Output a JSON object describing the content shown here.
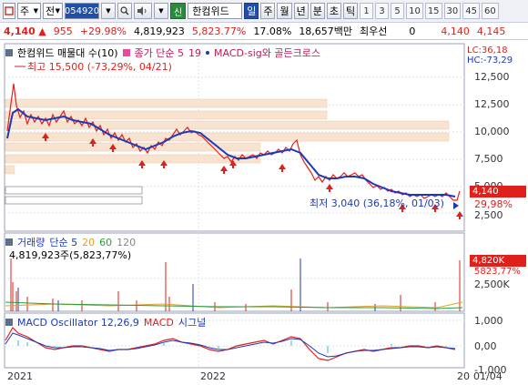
{
  "toolbar": {
    "market": "주",
    "market_sel": "전",
    "code": "054920",
    "sin": "신",
    "stock_name": "한컴위드",
    "periods": [
      "일",
      "주",
      "월",
      "년",
      "분",
      "초",
      "틱"
    ],
    "active_period": "일",
    "intervals": [
      "1",
      "3",
      "5",
      "10",
      "15",
      "30",
      "45",
      "60"
    ]
  },
  "quote": {
    "price": "4,140",
    "change": "955",
    "change_pct": "+29.98%",
    "volume": "4,819,923",
    "volume_ratio": "5,823.77%",
    "turnover": "17.08%",
    "amount": "18,657백만",
    "priority": "최우선",
    "priority_val": "0",
    "bid_price": "4,140",
    "ask_price": "4,145"
  },
  "chart": {
    "main_legend": {
      "name": "한컴위드 매물대 수(10)",
      "ma_label": "종가 단순 5",
      "ma_val": "19",
      "macd_label": "MACD-sig와 골든크로스"
    },
    "high_label": "최고 15,500 (-73,29%, 04/21)",
    "low_label": "최저 3,040 (36,18%, 01/03)",
    "lc_label": "LC:36,18",
    "hc_label": "HC:-73,29",
    "price_axis": [
      "12,500",
      "10,000",
      "7,500",
      "5,000",
      "2,500"
    ],
    "price_tag": "4,140",
    "price_pct": "29,98%",
    "volume_legend": {
      "name": "거래량",
      "ma": "단순 5",
      "p20": "20",
      "p60": "60",
      "p120": "120",
      "current": "4,819,923주(5,823,77%)"
    },
    "volume_tag": "4,820K",
    "volume_pct": "5823,77%",
    "volume_axis": [
      "2,500K"
    ],
    "macd_legend": {
      "name": "MACD Oscillator 12,26,9",
      "macd": "MACD",
      "signal": "시그널"
    },
    "macd_axis": [
      "1,000",
      "0,00",
      "-1,000"
    ],
    "date_axis": [
      "2021",
      "2022",
      "20",
      "01/04"
    ]
  }
}
